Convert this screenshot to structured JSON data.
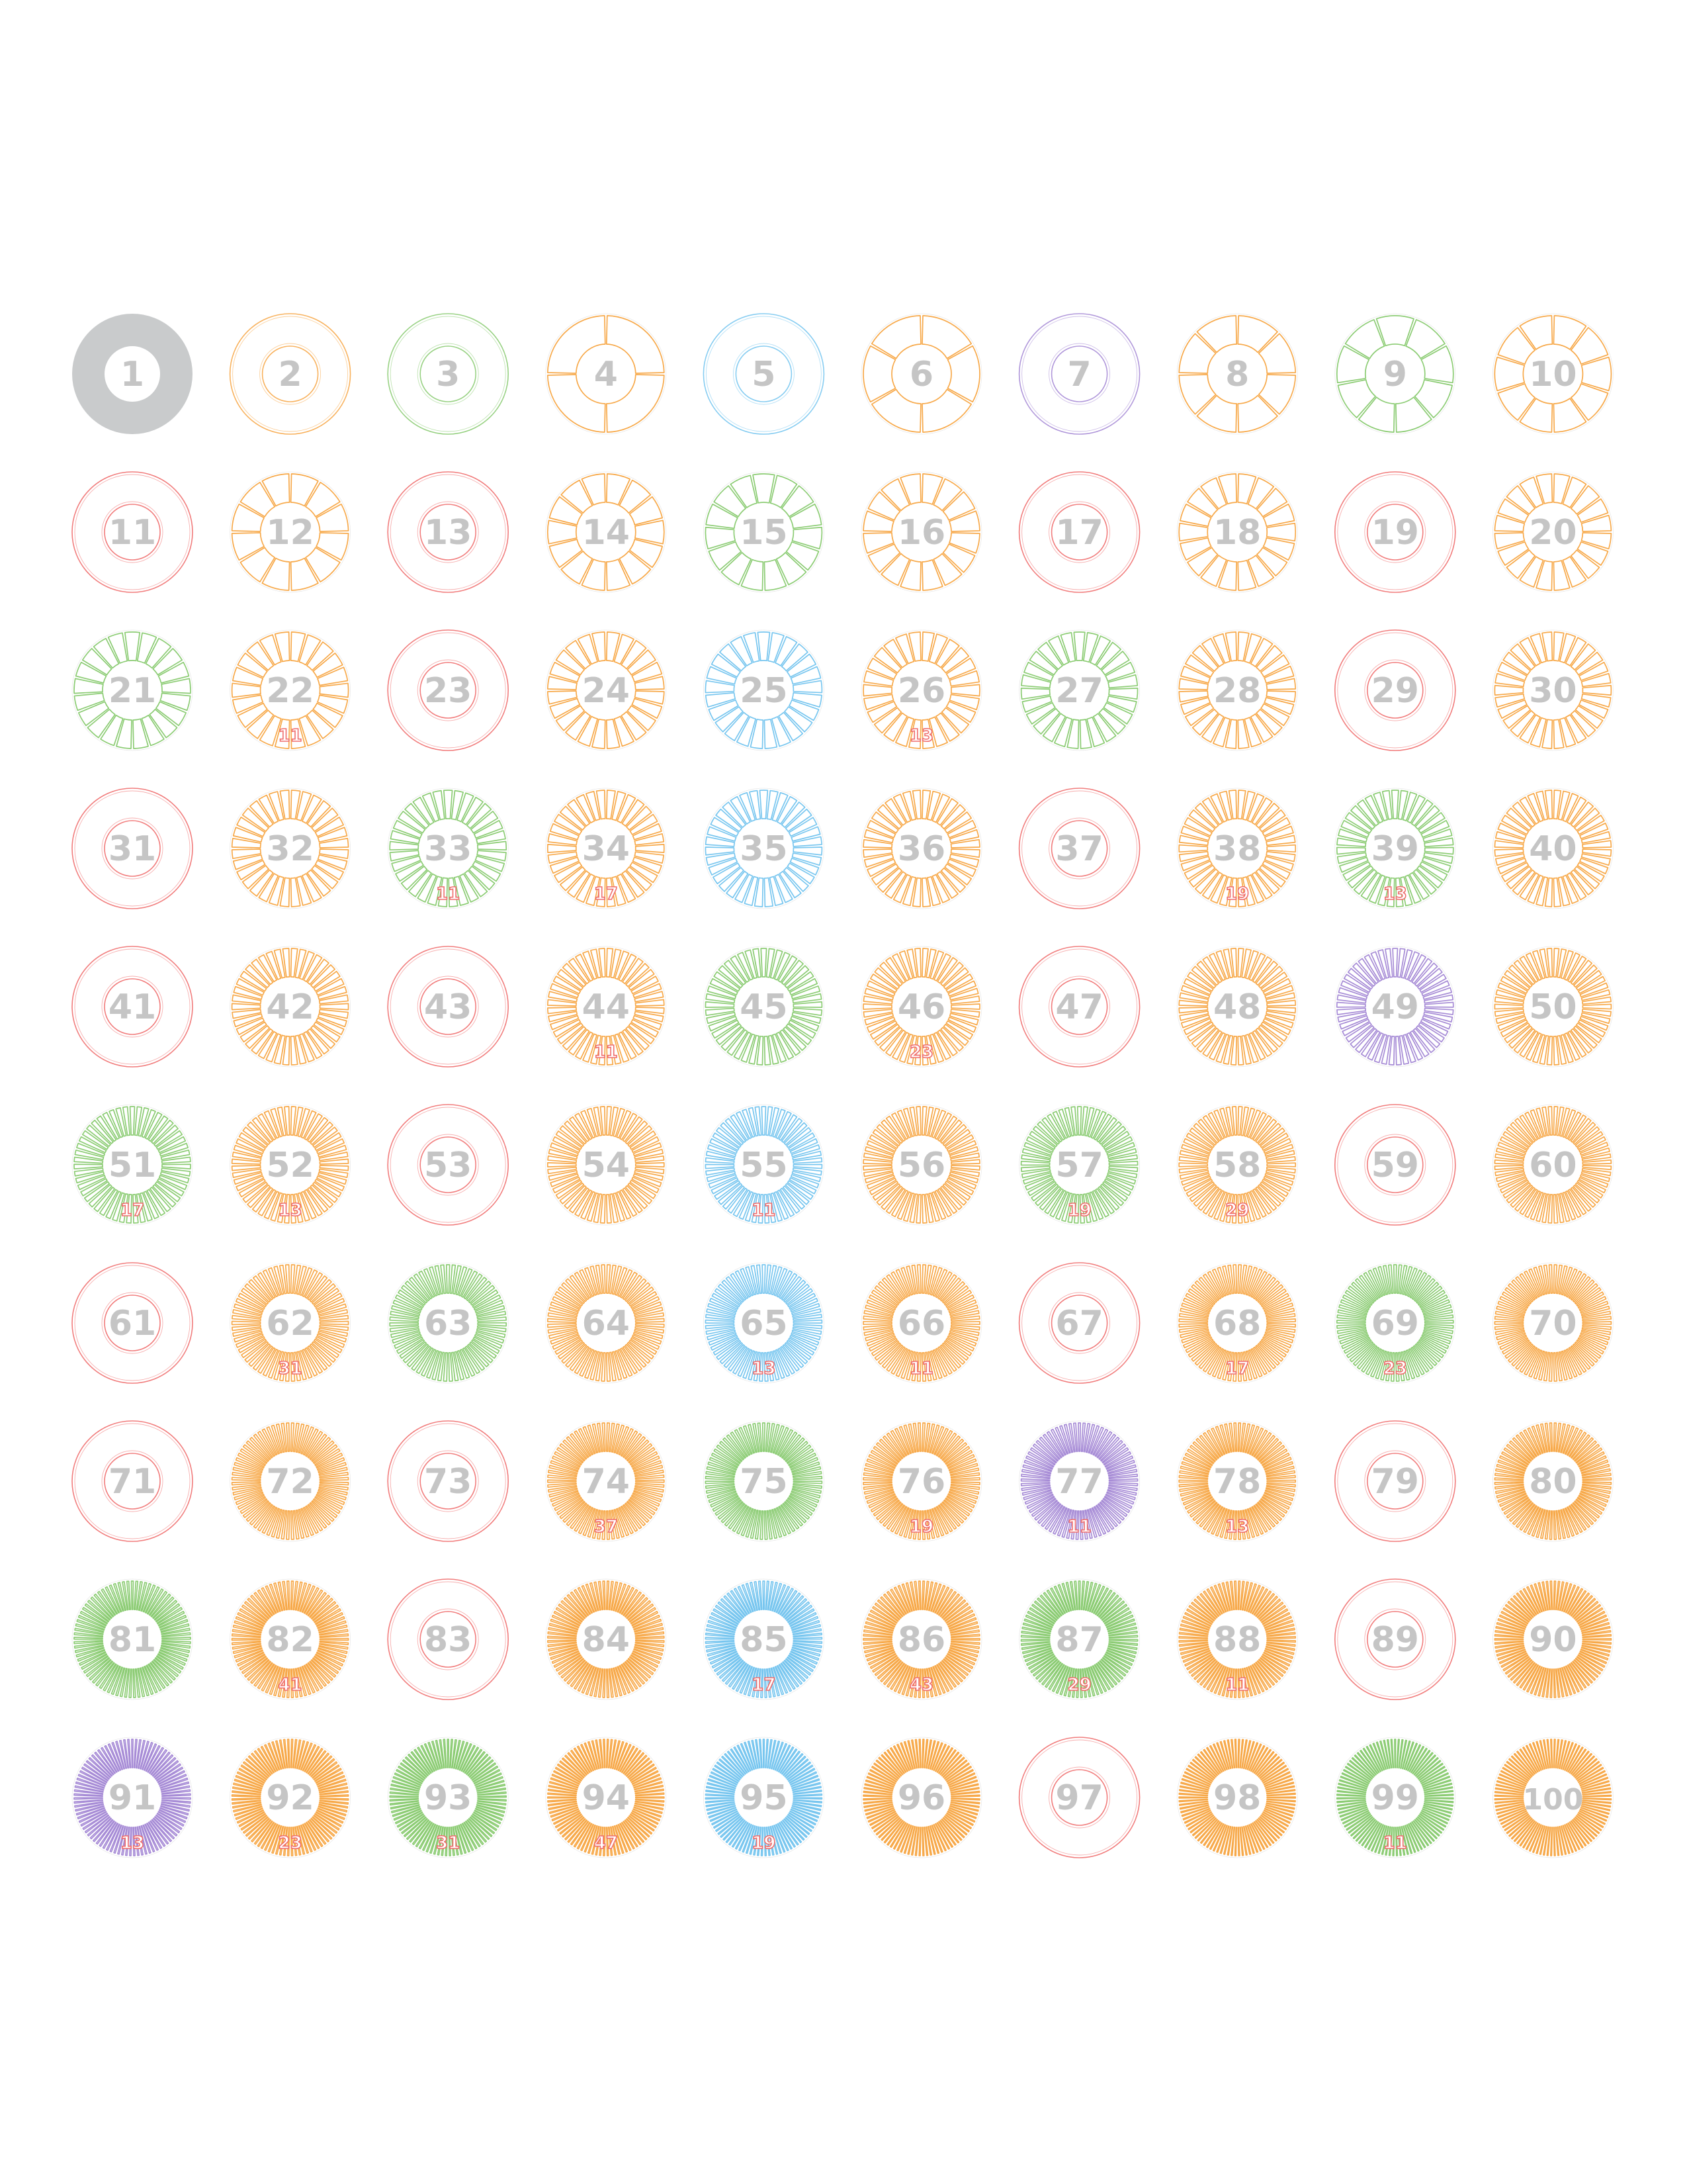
{
  "colors": {
    "2": "#f7a94a",
    "3": "#8ccc74",
    "5": "#78c6ef",
    "7": "#a78cd6",
    "big_prime": "#ef6e6e",
    "unit": "#c9cbcc",
    "number_text": "#c5c5c5"
  },
  "wheels": [
    {
      "n": 1,
      "label": "1",
      "factors": [],
      "big": null
    },
    {
      "n": 2,
      "label": "2",
      "factors": [
        2
      ],
      "big": null
    },
    {
      "n": 3,
      "label": "3",
      "factors": [
        3
      ],
      "big": null
    },
    {
      "n": 4,
      "label": "4",
      "factors": [
        2,
        2
      ],
      "big": null
    },
    {
      "n": 5,
      "label": "5",
      "factors": [
        5
      ],
      "big": null
    },
    {
      "n": 6,
      "label": "6",
      "factors": [
        2,
        3
      ],
      "big": null
    },
    {
      "n": 7,
      "label": "7",
      "factors": [
        7
      ],
      "big": null
    },
    {
      "n": 8,
      "label": "8",
      "factors": [
        2,
        2,
        2
      ],
      "big": null
    },
    {
      "n": 9,
      "label": "9",
      "factors": [
        3,
        3
      ],
      "big": null
    },
    {
      "n": 10,
      "label": "10",
      "factors": [
        2,
        5
      ],
      "big": null
    },
    {
      "n": 11,
      "label": "11",
      "factors": [
        11
      ],
      "big": null
    },
    {
      "n": 12,
      "label": "12",
      "factors": [
        2,
        2,
        3
      ],
      "big": null
    },
    {
      "n": 13,
      "label": "13",
      "factors": [
        13
      ],
      "big": null
    },
    {
      "n": 14,
      "label": "14",
      "factors": [
        2,
        7
      ],
      "big": null
    },
    {
      "n": 15,
      "label": "15",
      "factors": [
        3,
        5
      ],
      "big": null
    },
    {
      "n": 16,
      "label": "16",
      "factors": [
        2,
        2,
        2,
        2
      ],
      "big": null
    },
    {
      "n": 17,
      "label": "17",
      "factors": [
        17
      ],
      "big": null
    },
    {
      "n": 18,
      "label": "18",
      "factors": [
        2,
        3,
        3
      ],
      "big": null
    },
    {
      "n": 19,
      "label": "19",
      "factors": [
        19
      ],
      "big": null
    },
    {
      "n": 20,
      "label": "20",
      "factors": [
        2,
        2,
        5
      ],
      "big": null
    },
    {
      "n": 21,
      "label": "21",
      "factors": [
        3,
        7
      ],
      "big": null
    },
    {
      "n": 22,
      "label": "22",
      "factors": [
        2,
        11
      ],
      "big": "11"
    },
    {
      "n": 23,
      "label": "23",
      "factors": [
        23
      ],
      "big": null
    },
    {
      "n": 24,
      "label": "24",
      "factors": [
        2,
        2,
        2,
        3
      ],
      "big": null
    },
    {
      "n": 25,
      "label": "25",
      "factors": [
        5,
        5
      ],
      "big": null
    },
    {
      "n": 26,
      "label": "26",
      "factors": [
        2,
        13
      ],
      "big": "13"
    },
    {
      "n": 27,
      "label": "27",
      "factors": [
        3,
        3,
        3
      ],
      "big": null
    },
    {
      "n": 28,
      "label": "28",
      "factors": [
        2,
        2,
        7
      ],
      "big": null
    },
    {
      "n": 29,
      "label": "29",
      "factors": [
        29
      ],
      "big": null
    },
    {
      "n": 30,
      "label": "30",
      "factors": [
        2,
        3,
        5
      ],
      "big": null
    },
    {
      "n": 31,
      "label": "31",
      "factors": [
        31
      ],
      "big": null
    },
    {
      "n": 32,
      "label": "32",
      "factors": [
        2,
        2,
        2,
        2,
        2
      ],
      "big": null
    },
    {
      "n": 33,
      "label": "33",
      "factors": [
        3,
        11
      ],
      "big": "11"
    },
    {
      "n": 34,
      "label": "34",
      "factors": [
        2,
        17
      ],
      "big": "17"
    },
    {
      "n": 35,
      "label": "35",
      "factors": [
        5,
        7
      ],
      "big": null
    },
    {
      "n": 36,
      "label": "36",
      "factors": [
        2,
        2,
        3,
        3
      ],
      "big": null
    },
    {
      "n": 37,
      "label": "37",
      "factors": [
        37
      ],
      "big": null
    },
    {
      "n": 38,
      "label": "38",
      "factors": [
        2,
        19
      ],
      "big": "19"
    },
    {
      "n": 39,
      "label": "39",
      "factors": [
        3,
        13
      ],
      "big": "13"
    },
    {
      "n": 40,
      "label": "40",
      "factors": [
        2,
        2,
        2,
        5
      ],
      "big": null
    },
    {
      "n": 41,
      "label": "41",
      "factors": [
        41
      ],
      "big": null
    },
    {
      "n": 42,
      "label": "42",
      "factors": [
        2,
        3,
        7
      ],
      "big": null
    },
    {
      "n": 43,
      "label": "43",
      "factors": [
        43
      ],
      "big": null
    },
    {
      "n": 44,
      "label": "44",
      "factors": [
        2,
        2,
        11
      ],
      "big": "11"
    },
    {
      "n": 45,
      "label": "45",
      "factors": [
        3,
        3,
        5
      ],
      "big": null
    },
    {
      "n": 46,
      "label": "46",
      "factors": [
        2,
        23
      ],
      "big": "23"
    },
    {
      "n": 47,
      "label": "47",
      "factors": [
        47
      ],
      "big": null
    },
    {
      "n": 48,
      "label": "48",
      "factors": [
        2,
        2,
        2,
        2,
        3
      ],
      "big": null
    },
    {
      "n": 49,
      "label": "49",
      "factors": [
        7,
        7
      ],
      "big": null
    },
    {
      "n": 50,
      "label": "50",
      "factors": [
        2,
        5,
        5
      ],
      "big": null
    },
    {
      "n": 51,
      "label": "51",
      "factors": [
        3,
        17
      ],
      "big": "17"
    },
    {
      "n": 52,
      "label": "52",
      "factors": [
        2,
        2,
        13
      ],
      "big": "13"
    },
    {
      "n": 53,
      "label": "53",
      "factors": [
        53
      ],
      "big": null
    },
    {
      "n": 54,
      "label": "54",
      "factors": [
        2,
        3,
        3,
        3
      ],
      "big": null
    },
    {
      "n": 55,
      "label": "55",
      "factors": [
        5,
        11
      ],
      "big": "11"
    },
    {
      "n": 56,
      "label": "56",
      "factors": [
        2,
        2,
        2,
        7
      ],
      "big": null
    },
    {
      "n": 57,
      "label": "57",
      "factors": [
        3,
        19
      ],
      "big": "19"
    },
    {
      "n": 58,
      "label": "58",
      "factors": [
        2,
        29
      ],
      "big": "29"
    },
    {
      "n": 59,
      "label": "59",
      "factors": [
        59
      ],
      "big": null
    },
    {
      "n": 60,
      "label": "60",
      "factors": [
        2,
        2,
        3,
        5
      ],
      "big": null
    },
    {
      "n": 61,
      "label": "61",
      "factors": [
        61
      ],
      "big": null
    },
    {
      "n": 62,
      "label": "62",
      "factors": [
        2,
        31
      ],
      "big": "31"
    },
    {
      "n": 63,
      "label": "63",
      "factors": [
        3,
        3,
        7
      ],
      "big": null
    },
    {
      "n": 64,
      "label": "64",
      "factors": [
        2,
        2,
        2,
        2,
        2,
        2
      ],
      "big": null
    },
    {
      "n": 65,
      "label": "65",
      "factors": [
        5,
        13
      ],
      "big": "13"
    },
    {
      "n": 66,
      "label": "66",
      "factors": [
        2,
        3,
        11
      ],
      "big": "11"
    },
    {
      "n": 67,
      "label": "67",
      "factors": [
        67
      ],
      "big": null
    },
    {
      "n": 68,
      "label": "68",
      "factors": [
        2,
        2,
        17
      ],
      "big": "17"
    },
    {
      "n": 69,
      "label": "69",
      "factors": [
        3,
        23
      ],
      "big": "23"
    },
    {
      "n": 70,
      "label": "70",
      "factors": [
        2,
        5,
        7
      ],
      "big": null
    },
    {
      "n": 71,
      "label": "71",
      "factors": [
        71
      ],
      "big": null
    },
    {
      "n": 72,
      "label": "72",
      "factors": [
        2,
        2,
        2,
        3,
        3
      ],
      "big": null
    },
    {
      "n": 73,
      "label": "73",
      "factors": [
        73
      ],
      "big": null
    },
    {
      "n": 74,
      "label": "74",
      "factors": [
        2,
        37
      ],
      "big": "37"
    },
    {
      "n": 75,
      "label": "75",
      "factors": [
        3,
        5,
        5
      ],
      "big": null
    },
    {
      "n": 76,
      "label": "76",
      "factors": [
        2,
        2,
        19
      ],
      "big": "19"
    },
    {
      "n": 77,
      "label": "77",
      "factors": [
        7,
        11
      ],
      "big": "11"
    },
    {
      "n": 78,
      "label": "78",
      "factors": [
        2,
        3,
        13
      ],
      "big": "13"
    },
    {
      "n": 79,
      "label": "79",
      "factors": [
        79
      ],
      "big": null
    },
    {
      "n": 80,
      "label": "80",
      "factors": [
        2,
        2,
        2,
        2,
        5
      ],
      "big": null
    },
    {
      "n": 81,
      "label": "81",
      "factors": [
        3,
        3,
        3,
        3
      ],
      "big": null
    },
    {
      "n": 82,
      "label": "82",
      "factors": [
        2,
        41
      ],
      "big": "41"
    },
    {
      "n": 83,
      "label": "83",
      "factors": [
        83
      ],
      "big": null
    },
    {
      "n": 84,
      "label": "84",
      "factors": [
        2,
        2,
        3,
        7
      ],
      "big": null
    },
    {
      "n": 85,
      "label": "85",
      "factors": [
        5,
        17
      ],
      "big": "17"
    },
    {
      "n": 86,
      "label": "86",
      "factors": [
        2,
        43
      ],
      "big": "43"
    },
    {
      "n": 87,
      "label": "87",
      "factors": [
        3,
        29
      ],
      "big": "29"
    },
    {
      "n": 88,
      "label": "88",
      "factors": [
        2,
        2,
        2,
        11
      ],
      "big": "11"
    },
    {
      "n": 89,
      "label": "89",
      "factors": [
        89
      ],
      "big": null
    },
    {
      "n": 90,
      "label": "90",
      "factors": [
        2,
        3,
        3,
        5
      ],
      "big": null
    },
    {
      "n": 91,
      "label": "91",
      "factors": [
        7,
        13
      ],
      "big": "13"
    },
    {
      "n": 92,
      "label": "92",
      "factors": [
        2,
        2,
        23
      ],
      "big": "23"
    },
    {
      "n": 93,
      "label": "93",
      "factors": [
        3,
        31
      ],
      "big": "31"
    },
    {
      "n": 94,
      "label": "94",
      "factors": [
        2,
        47
      ],
      "big": "47"
    },
    {
      "n": 95,
      "label": "95",
      "factors": [
        5,
        19
      ],
      "big": "19"
    },
    {
      "n": 96,
      "label": "96",
      "factors": [
        2,
        2,
        2,
        2,
        2,
        3
      ],
      "big": null
    },
    {
      "n": 97,
      "label": "97",
      "factors": [
        97
      ],
      "big": null
    },
    {
      "n": 98,
      "label": "98",
      "factors": [
        2,
        7,
        7
      ],
      "big": null
    },
    {
      "n": 99,
      "label": "99",
      "factors": [
        3,
        3,
        11
      ],
      "big": "11"
    },
    {
      "n": 100,
      "label": "100",
      "factors": [
        2,
        2,
        5,
        5
      ],
      "big": null
    }
  ]
}
